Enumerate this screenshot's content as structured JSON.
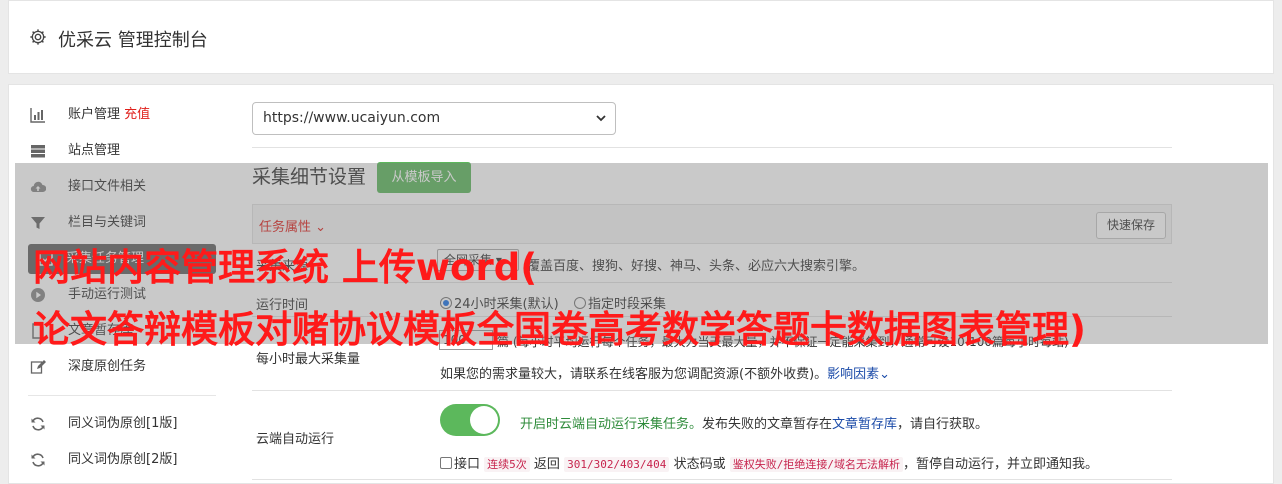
{
  "header": {
    "title": "优采云 管理控制台",
    "icon": "gear-icon"
  },
  "sidebar": {
    "items": [
      {
        "label": "账户管理",
        "extra": "充值",
        "icon": "bar-chart-icon"
      },
      {
        "label": "站点管理",
        "icon": "server-icon"
      },
      {
        "label": "接口文件相关",
        "icon": "cloud-upload-icon"
      },
      {
        "label": "栏目与关键词",
        "icon": "filter-icon"
      },
      {
        "label": "采集任务管理",
        "icon": "task-icon"
      },
      {
        "label": "手动运行测试",
        "icon": "play-icon"
      },
      {
        "label": "文章暂存库",
        "icon": "file-icon"
      },
      {
        "label": "深度原创任务",
        "icon": "edit-icon"
      },
      {
        "label": "同义词伪原创[1版]",
        "icon": "refresh-icon"
      },
      {
        "label": "同义词伪原创[2版]",
        "icon": "refresh-icon"
      }
    ]
  },
  "site_select": {
    "value": "https://www.ucaiyun.com"
  },
  "settings": {
    "title": "采集细节设置",
    "import_button": "从模板导入",
    "task_props": "任务属性",
    "quick_save": "快速保存",
    "scope": {
      "label": "采集来源",
      "select_value": "全网采集",
      "desc": "覆盖百度、搜狗、好搜、神马、头条、必应六大搜索引擎。"
    },
    "run_time": {
      "label": "运行时间",
      "opt1": "24小时采集(默认)",
      "opt2": "指定时段采集"
    },
    "max_per_hour": {
      "label": "每小时最大采集量",
      "value": "100",
      "desc1": "篇 (每小时平均运行每个任务，最大为当天最大量，并不保证一定能采集到，通常可设10-100篇每小时每站)",
      "desc2": "如果您的需求量较大，请联系在线客服为您调配资源(不额外收费)。",
      "link": "影响因素"
    },
    "cloud_auto": {
      "label": "云端自动运行",
      "desc_green": "开启时云端自动运行采集任务。",
      "desc_mid": "发布失败的文章暂存在",
      "desc_link": "文章暂存库",
      "desc_end": "，请自行获取。",
      "chk_label": "接口",
      "code1": "连续5次",
      "t_return": "返回",
      "code2": "301/302/403/404",
      "t_status": "状态码或",
      "code3": "鉴权失败/拒绝连接/域名无法解析",
      "t_end": "，暂停自动运行，并立即通知我。"
    }
  },
  "overlay": {
    "line1": "网站内容管理系统 上传word(",
    "line2": "论文答辩模板对赌协议模板全国卷高考数学答题卡数据图表管理)"
  },
  "colors": {
    "accent": "#5cb85c",
    "danger": "#e0201b",
    "link": "#1a4aa8",
    "overlay_text": "#ff1a1a"
  }
}
